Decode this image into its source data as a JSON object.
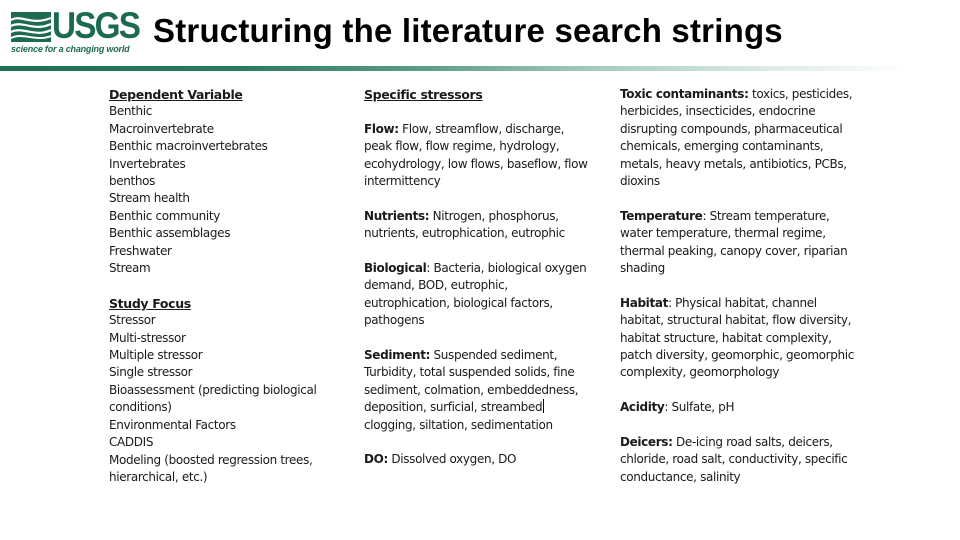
{
  "header": {
    "logo": {
      "wordmark": "USGS",
      "tagline": "science for a changing world",
      "brand_color": "#1d6b4f"
    },
    "title": "Structuring the literature search strings"
  },
  "columns": {
    "dependent_variable": {
      "heading": "Dependent Variable",
      "items": [
        "Benthic",
        "Macroinvertebrate",
        "Benthic macroinvertebrates",
        "Invertebrates",
        "benthos",
        "Stream health",
        "Benthic community",
        "Benthic assemblages",
        "Freshwater",
        "Stream"
      ]
    },
    "study_focus": {
      "heading": "Study Focus",
      "items": [
        "Stressor",
        "Multi-stressor",
        "Multiple stressor",
        "Single stressor",
        "Bioassessment (predicting biological conditions)",
        "Environmental Factors",
        "CADDIS",
        "Modeling (boosted regression trees, hierarchical, etc.)"
      ]
    },
    "specific_stressors": {
      "heading": "Specific stressors",
      "groups": [
        {
          "label": "Flow:",
          "terms": " Flow, streamflow, discharge, peak flow, flow regime, hydrology, ecohydrology, low flows, baseflow, flow intermittency"
        },
        {
          "label": "Nutrients:",
          "terms": " Nitrogen, phosphorus, nutrients, eutrophication, eutrophic"
        },
        {
          "label": "Biological",
          "terms": ": Bacteria, biological oxygen demand, BOD, eutrophic, eutrophication, biological factors, pathogens"
        },
        {
          "label": "Sediment:",
          "terms_before_cursor": " Suspended sediment, Turbidity, total suspended solids, fine sediment, colmation, embeddedness, deposition, surficial, streambed",
          "terms_after_cursor": "clogging,  siltation, sedimentation"
        },
        {
          "label": "DO:",
          "terms": " Dissolved oxygen, DO"
        }
      ]
    },
    "more_stressors": {
      "groups": [
        {
          "label": "Toxic contaminants:",
          "terms": " toxics, pesticides, herbicides, insecticides, endocrine disrupting compounds, pharmaceutical chemicals, emerging contaminants, metals, heavy metals, antibiotics, PCBs, dioxins"
        },
        {
          "label": "Temperature",
          "terms": ": Stream temperature, water temperature, thermal regime, thermal peaking, canopy cover, riparian shading"
        },
        {
          "label": "Habitat",
          "terms": ": Physical habitat, channel habitat, structural habitat, flow diversity, habitat structure, habitat complexity, patch diversity, geomorphic, geomorphic complexity, geomorphology"
        },
        {
          "label": "Acidity",
          "terms": ": Sulfate, pH"
        },
        {
          "label": "Deicers:",
          "terms": " De-icing road salts, deicers, chloride, road salt, conductivity, specific conductance, salinity"
        }
      ]
    }
  }
}
